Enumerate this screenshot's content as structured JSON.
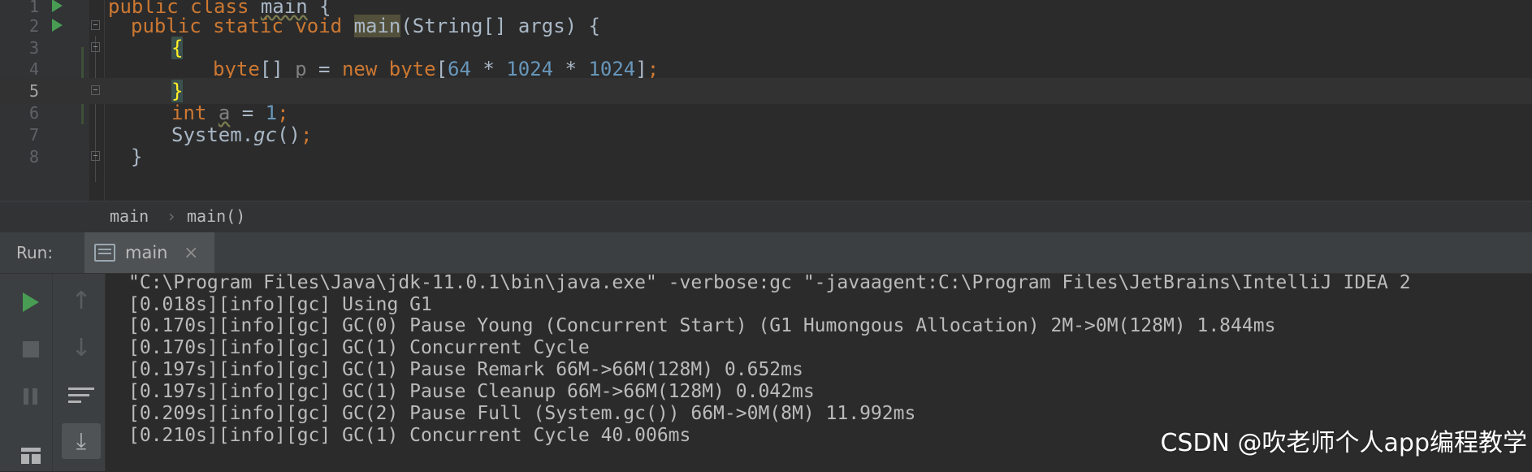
{
  "editor": {
    "lines": [
      {
        "num": "1",
        "run_marker": true,
        "fold": false
      },
      {
        "num": "2",
        "run_marker": true,
        "fold": true
      },
      {
        "num": "3",
        "run_marker": false,
        "fold": true
      },
      {
        "num": "4",
        "run_marker": false,
        "fold": false
      },
      {
        "num": "5",
        "run_marker": false,
        "fold": true,
        "current": true
      },
      {
        "num": "6",
        "run_marker": false,
        "fold": false
      },
      {
        "num": "7",
        "run_marker": false,
        "fold": false
      },
      {
        "num": "8",
        "run_marker": false,
        "fold": true
      }
    ],
    "code": {
      "l1_kw1": "public",
      "l1_kw2": "class",
      "l1_name": "main",
      "l1_brace": "{",
      "l2_kw1": "public",
      "l2_kw2": "static",
      "l2_kw3": "void",
      "l2_method": "main",
      "l2_params": "(String[] args) {",
      "l3_brace": "{",
      "l4_type": "byte",
      "l4_arr": "[] ",
      "l4_var": "p",
      "l4_eq": " = ",
      "l4_new": "new",
      "l4_type2": "byte",
      "l4_open": "[",
      "l4_n1": "64",
      "l4_op1": " * ",
      "l4_n2": "1024",
      "l4_op2": " * ",
      "l4_n3": "1024",
      "l4_close": "]",
      "l4_semi": ";",
      "l5_brace": "}",
      "l6_kw": "int",
      "l6_var": "a",
      "l6_eq": " = ",
      "l6_num": "1",
      "l6_semi": ";",
      "l7_obj": "System.",
      "l7_method": "gc",
      "l7_call": "()",
      "l7_semi": ";",
      "l8_brace": "}"
    },
    "breadcrumb": {
      "class_name": "main",
      "method_name": "main()",
      "separator": "›"
    }
  },
  "run_window": {
    "label": "Run:",
    "tab": {
      "label": "main",
      "close": "×"
    },
    "toolbar_icons": [
      "rerun-icon",
      "up-arrow-icon",
      "stop-icon",
      "down-arrow-icon",
      "pause-icon",
      "soft-wrap-icon",
      "scroll-to-end-icon",
      "layout-icon"
    ],
    "console_lines": [
      "\"C:\\Program Files\\Java\\jdk-11.0.1\\bin\\java.exe\" -verbose:gc \"-javaagent:C:\\Program Files\\JetBrains\\IntelliJ IDEA 2",
      "[0.018s][info][gc] Using G1",
      "[0.170s][info][gc] GC(0) Pause Young (Concurrent Start) (G1 Humongous Allocation) 2M->0M(128M) 1.844ms",
      "[0.170s][info][gc] GC(1) Concurrent Cycle",
      "[0.197s][info][gc] GC(1) Pause Remark 66M->66M(128M) 0.652ms",
      "[0.197s][info][gc] GC(1) Pause Cleanup 66M->66M(128M) 0.042ms",
      "[0.209s][info][gc] GC(2) Pause Full (System.gc()) 66M->0M(8M) 11.992ms",
      "[0.210s][info][gc] GC(1) Concurrent Cycle 40.006ms"
    ]
  },
  "watermark": "CSDN @吹老师个人app编程教学",
  "colors": {
    "editor_bg": "#2b2b2b",
    "keyword": "#cc7832",
    "number": "#6897bb",
    "run_green": "#499c54",
    "brace_highlight": "#ffef28"
  }
}
